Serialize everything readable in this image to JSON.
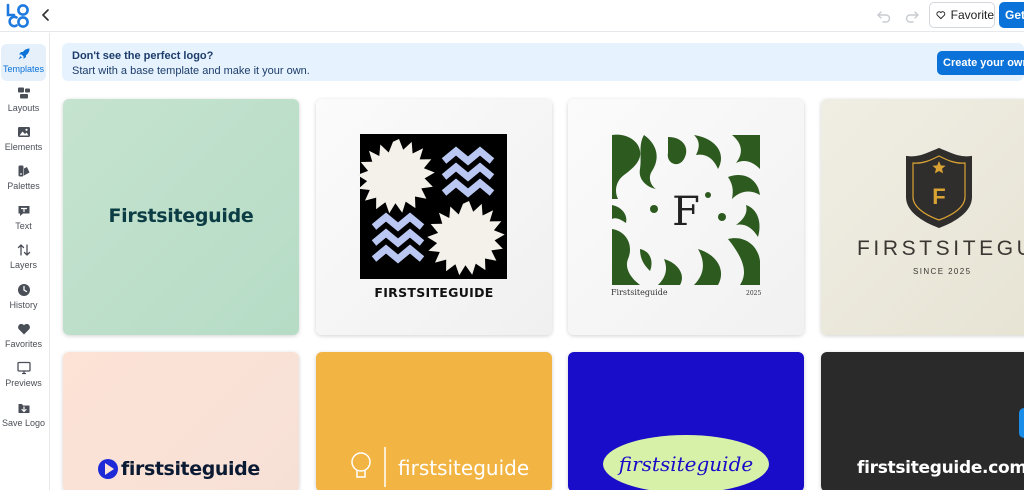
{
  "topbar": {
    "favorite_label": "Favorite",
    "get_label": "Get"
  },
  "sidebar": {
    "items": [
      {
        "label": "Templates",
        "icon": "rocket-icon",
        "active": true
      },
      {
        "label": "Layouts",
        "icon": "layouts-icon",
        "active": false
      },
      {
        "label": "Elements",
        "icon": "image-icon",
        "active": false
      },
      {
        "label": "Palettes",
        "icon": "palette-icon",
        "active": false
      },
      {
        "label": "Text",
        "icon": "text-bubble-icon",
        "active": false
      },
      {
        "label": "Layers",
        "icon": "layers-icon",
        "active": false
      },
      {
        "label": "History",
        "icon": "clock-icon",
        "active": false
      },
      {
        "label": "Favorites",
        "icon": "heart-icon",
        "active": false
      },
      {
        "label": "Previews",
        "icon": "monitor-icon",
        "active": false
      },
      {
        "label": "Save Logo",
        "icon": "download-icon",
        "active": false
      }
    ]
  },
  "banner": {
    "title": "Don't see the perfect logo?",
    "subtitle": "Start with a base template and make it your own.",
    "button_label": "Create your own l"
  },
  "templates": [
    {
      "brand": "Firstsiteguide"
    },
    {
      "brand": "FIRSTSITEGUIDE"
    },
    {
      "brand": "Firstsiteguide",
      "monogram": "F",
      "year": "2025"
    },
    {
      "brand": "FIRSTSITEGUIDE",
      "monogram": "F",
      "tagline": "SINCE 2025"
    },
    {
      "brand": "firstsiteguide"
    },
    {
      "brand": "firstsiteguide"
    },
    {
      "brand": "firstsiteguide"
    },
    {
      "brand": "firstsiteguide.com"
    }
  ],
  "colors": {
    "accent": "#0a72d8",
    "banner_bg": "#e6f2fd"
  }
}
